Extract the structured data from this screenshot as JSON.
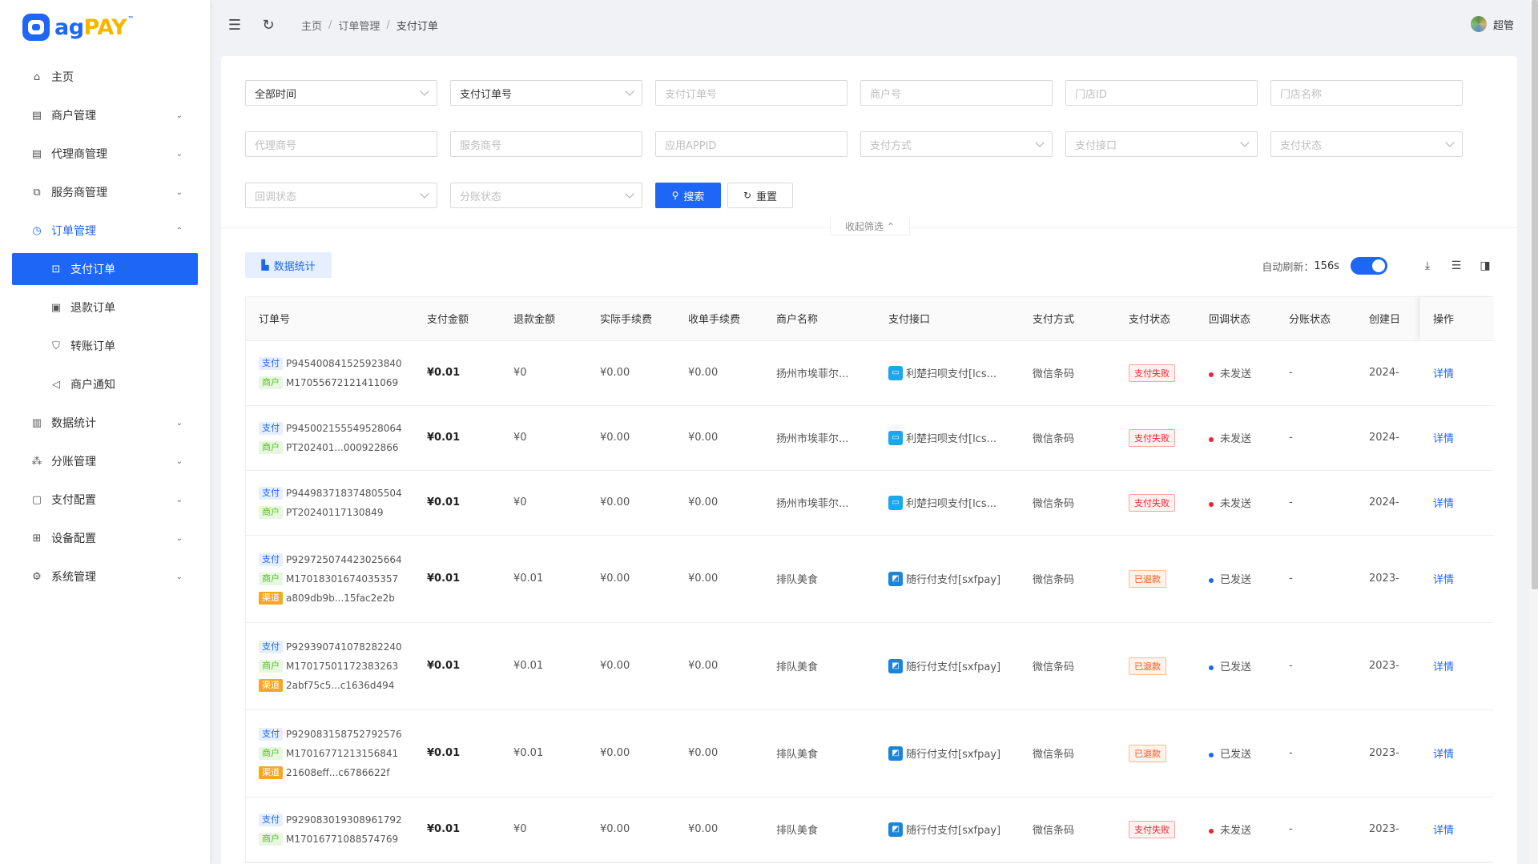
{
  "brand": {
    "ag": "ag",
    "pay": "PAY",
    "tm": "™"
  },
  "user": {
    "name": "超管"
  },
  "breadcrumb": [
    "主页",
    "订单管理",
    "支付订单"
  ],
  "sidebar": {
    "items": [
      {
        "label": "主页",
        "icon": "home-icon"
      },
      {
        "label": "商户管理",
        "icon": "store-icon"
      },
      {
        "label": "代理商管理",
        "icon": "store-icon"
      },
      {
        "label": "服务商管理",
        "icon": "copy-icon"
      },
      {
        "label": "订单管理",
        "icon": "clock-icon"
      },
      {
        "label": "数据统计",
        "icon": "chart-icon"
      },
      {
        "label": "分账管理",
        "icon": "cluster-icon"
      },
      {
        "label": "支付配置",
        "icon": "file-icon"
      },
      {
        "label": "设备配置",
        "icon": "grid-icon"
      },
      {
        "label": "系统管理",
        "icon": "gear-icon"
      }
    ],
    "sub": [
      {
        "label": "支付订单",
        "icon": "order-icon"
      },
      {
        "label": "退款订单",
        "icon": "refund-icon"
      },
      {
        "label": "转账订单",
        "icon": "shield-icon"
      },
      {
        "label": "商户通知",
        "icon": "sound-icon"
      }
    ]
  },
  "filters": {
    "time": "全部时间",
    "order_type": "支付订单号",
    "order_no_ph": "支付订单号",
    "mch_no_ph": "商户号",
    "store_id_ph": "门店ID",
    "store_name_ph": "门店名称",
    "agent_no_ph": "代理商号",
    "isv_no_ph": "服务商号",
    "appid_ph": "应用APPID",
    "way_ph": "支付方式",
    "iface_ph": "支付接口",
    "state_ph": "支付状态",
    "notify_ph": "回调状态",
    "division_ph": "分账状态",
    "search": "搜索",
    "reset": "重置",
    "collapse": "收起筛选"
  },
  "toolbar": {
    "stat": "数据统计",
    "refresh_label": "自动刷新：",
    "refresh_val": "156s"
  },
  "columns": [
    "订单号",
    "支付金额",
    "退款金额",
    "实际手续费",
    "收单手续费",
    "商户名称",
    "支付接口",
    "支付方式",
    "支付状态",
    "回调状态",
    "分账状态",
    "创建日",
    "操作"
  ],
  "tags": {
    "pay": "支付",
    "mch": "商户",
    "chn": "渠道"
  },
  "rows": [
    {
      "pay_no": "P945400841525923840",
      "mch_no": "M17055672121411069",
      "amount": "¥0.01",
      "refund": "¥0",
      "fee": "¥0.00",
      "acq_fee": "¥0.00",
      "mch_name": "扬州市埃菲尔...",
      "iface": "利楚扫呗支付[lcs...",
      "way": "微信条码",
      "state": "支付失败",
      "notify": "未发送",
      "division": "-",
      "created": "2024-",
      "op": "详情"
    },
    {
      "pay_no": "P945002155549528064",
      "mch_no": "PT202401...000922866",
      "amount": "¥0.01",
      "refund": "¥0",
      "fee": "¥0.00",
      "acq_fee": "¥0.00",
      "mch_name": "扬州市埃菲尔...",
      "iface": "利楚扫呗支付[lcs...",
      "way": "微信条码",
      "state": "支付失败",
      "notify": "未发送",
      "division": "-",
      "created": "2024-",
      "op": "详情"
    },
    {
      "pay_no": "P944983718374805504",
      "mch_no": "PT20240117130849",
      "amount": "¥0.01",
      "refund": "¥0",
      "fee": "¥0.00",
      "acq_fee": "¥0.00",
      "mch_name": "扬州市埃菲尔...",
      "iface": "利楚扫呗支付[lcs...",
      "way": "微信条码",
      "state": "支付失败",
      "notify": "未发送",
      "division": "-",
      "created": "2024-",
      "op": "详情"
    },
    {
      "pay_no": "P929725074423025664",
      "mch_no": "M17018301674035357",
      "chn_no": "a809db9b...15fac2e2b",
      "amount": "¥0.01",
      "refund": "¥0.01",
      "fee": "¥0.00",
      "acq_fee": "¥0.00",
      "mch_name": "排队美食",
      "iface": "随行付支付[sxfpay]",
      "way": "微信条码",
      "state": "已退款",
      "notify": "已发送",
      "division": "-",
      "created": "2023-",
      "op": "详情"
    },
    {
      "pay_no": "P929390741078282240",
      "mch_no": "M17017501172383263",
      "chn_no": "2abf75c5...c1636d494",
      "amount": "¥0.01",
      "refund": "¥0.01",
      "fee": "¥0.00",
      "acq_fee": "¥0.00",
      "mch_name": "排队美食",
      "iface": "随行付支付[sxfpay]",
      "way": "微信条码",
      "state": "已退款",
      "notify": "已发送",
      "division": "-",
      "created": "2023-",
      "op": "详情"
    },
    {
      "pay_no": "P929083158752792576",
      "mch_no": "M17016771213156841",
      "chn_no": "21608eff...c6786622f",
      "amount": "¥0.01",
      "refund": "¥0.01",
      "fee": "¥0.00",
      "acq_fee": "¥0.00",
      "mch_name": "排队美食",
      "iface": "随行付支付[sxfpay]",
      "way": "微信条码",
      "state": "已退款",
      "notify": "已发送",
      "division": "-",
      "created": "2023-",
      "op": "详情"
    },
    {
      "pay_no": "P929083019308961792",
      "mch_no": "M17016771088574769",
      "amount": "¥0.01",
      "refund": "¥0",
      "fee": "¥0.00",
      "acq_fee": "¥0.00",
      "mch_name": "排队美食",
      "iface": "随行付支付[sxfpay]",
      "way": "微信条码",
      "state": "支付失败",
      "notify": "未发送",
      "division": "-",
      "created": "2023-",
      "op": "详情"
    }
  ]
}
